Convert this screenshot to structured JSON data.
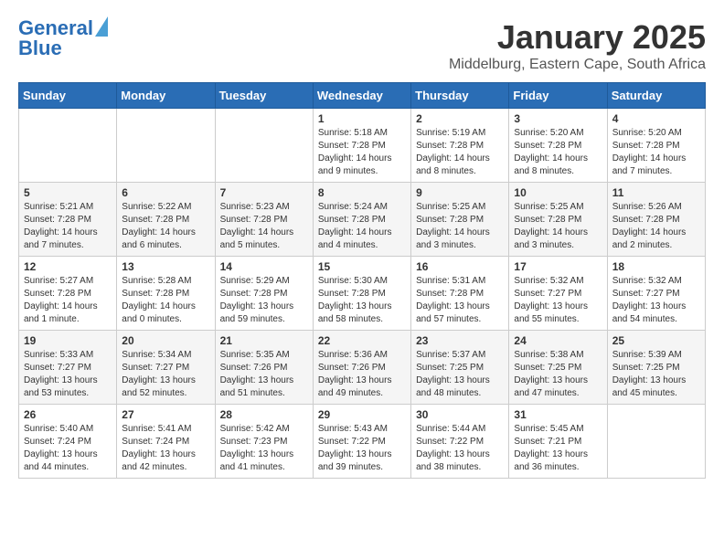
{
  "header": {
    "logo_line1": "General",
    "logo_line2": "Blue",
    "month": "January 2025",
    "location": "Middelburg, Eastern Cape, South Africa"
  },
  "days_of_week": [
    "Sunday",
    "Monday",
    "Tuesday",
    "Wednesday",
    "Thursday",
    "Friday",
    "Saturday"
  ],
  "weeks": [
    [
      {
        "day": "",
        "content": ""
      },
      {
        "day": "",
        "content": ""
      },
      {
        "day": "",
        "content": ""
      },
      {
        "day": "1",
        "content": "Sunrise: 5:18 AM\nSunset: 7:28 PM\nDaylight: 14 hours and 9 minutes."
      },
      {
        "day": "2",
        "content": "Sunrise: 5:19 AM\nSunset: 7:28 PM\nDaylight: 14 hours and 8 minutes."
      },
      {
        "day": "3",
        "content": "Sunrise: 5:20 AM\nSunset: 7:28 PM\nDaylight: 14 hours and 8 minutes."
      },
      {
        "day": "4",
        "content": "Sunrise: 5:20 AM\nSunset: 7:28 PM\nDaylight: 14 hours and 7 minutes."
      }
    ],
    [
      {
        "day": "5",
        "content": "Sunrise: 5:21 AM\nSunset: 7:28 PM\nDaylight: 14 hours and 7 minutes."
      },
      {
        "day": "6",
        "content": "Sunrise: 5:22 AM\nSunset: 7:28 PM\nDaylight: 14 hours and 6 minutes."
      },
      {
        "day": "7",
        "content": "Sunrise: 5:23 AM\nSunset: 7:28 PM\nDaylight: 14 hours and 5 minutes."
      },
      {
        "day": "8",
        "content": "Sunrise: 5:24 AM\nSunset: 7:28 PM\nDaylight: 14 hours and 4 minutes."
      },
      {
        "day": "9",
        "content": "Sunrise: 5:25 AM\nSunset: 7:28 PM\nDaylight: 14 hours and 3 minutes."
      },
      {
        "day": "10",
        "content": "Sunrise: 5:25 AM\nSunset: 7:28 PM\nDaylight: 14 hours and 3 minutes."
      },
      {
        "day": "11",
        "content": "Sunrise: 5:26 AM\nSunset: 7:28 PM\nDaylight: 14 hours and 2 minutes."
      }
    ],
    [
      {
        "day": "12",
        "content": "Sunrise: 5:27 AM\nSunset: 7:28 PM\nDaylight: 14 hours and 1 minute."
      },
      {
        "day": "13",
        "content": "Sunrise: 5:28 AM\nSunset: 7:28 PM\nDaylight: 14 hours and 0 minutes."
      },
      {
        "day": "14",
        "content": "Sunrise: 5:29 AM\nSunset: 7:28 PM\nDaylight: 13 hours and 59 minutes."
      },
      {
        "day": "15",
        "content": "Sunrise: 5:30 AM\nSunset: 7:28 PM\nDaylight: 13 hours and 58 minutes."
      },
      {
        "day": "16",
        "content": "Sunrise: 5:31 AM\nSunset: 7:28 PM\nDaylight: 13 hours and 57 minutes."
      },
      {
        "day": "17",
        "content": "Sunrise: 5:32 AM\nSunset: 7:27 PM\nDaylight: 13 hours and 55 minutes."
      },
      {
        "day": "18",
        "content": "Sunrise: 5:32 AM\nSunset: 7:27 PM\nDaylight: 13 hours and 54 minutes."
      }
    ],
    [
      {
        "day": "19",
        "content": "Sunrise: 5:33 AM\nSunset: 7:27 PM\nDaylight: 13 hours and 53 minutes."
      },
      {
        "day": "20",
        "content": "Sunrise: 5:34 AM\nSunset: 7:27 PM\nDaylight: 13 hours and 52 minutes."
      },
      {
        "day": "21",
        "content": "Sunrise: 5:35 AM\nSunset: 7:26 PM\nDaylight: 13 hours and 51 minutes."
      },
      {
        "day": "22",
        "content": "Sunrise: 5:36 AM\nSunset: 7:26 PM\nDaylight: 13 hours and 49 minutes."
      },
      {
        "day": "23",
        "content": "Sunrise: 5:37 AM\nSunset: 7:25 PM\nDaylight: 13 hours and 48 minutes."
      },
      {
        "day": "24",
        "content": "Sunrise: 5:38 AM\nSunset: 7:25 PM\nDaylight: 13 hours and 47 minutes."
      },
      {
        "day": "25",
        "content": "Sunrise: 5:39 AM\nSunset: 7:25 PM\nDaylight: 13 hours and 45 minutes."
      }
    ],
    [
      {
        "day": "26",
        "content": "Sunrise: 5:40 AM\nSunset: 7:24 PM\nDaylight: 13 hours and 44 minutes."
      },
      {
        "day": "27",
        "content": "Sunrise: 5:41 AM\nSunset: 7:24 PM\nDaylight: 13 hours and 42 minutes."
      },
      {
        "day": "28",
        "content": "Sunrise: 5:42 AM\nSunset: 7:23 PM\nDaylight: 13 hours and 41 minutes."
      },
      {
        "day": "29",
        "content": "Sunrise: 5:43 AM\nSunset: 7:22 PM\nDaylight: 13 hours and 39 minutes."
      },
      {
        "day": "30",
        "content": "Sunrise: 5:44 AM\nSunset: 7:22 PM\nDaylight: 13 hours and 38 minutes."
      },
      {
        "day": "31",
        "content": "Sunrise: 5:45 AM\nSunset: 7:21 PM\nDaylight: 13 hours and 36 minutes."
      },
      {
        "day": "",
        "content": ""
      }
    ]
  ]
}
